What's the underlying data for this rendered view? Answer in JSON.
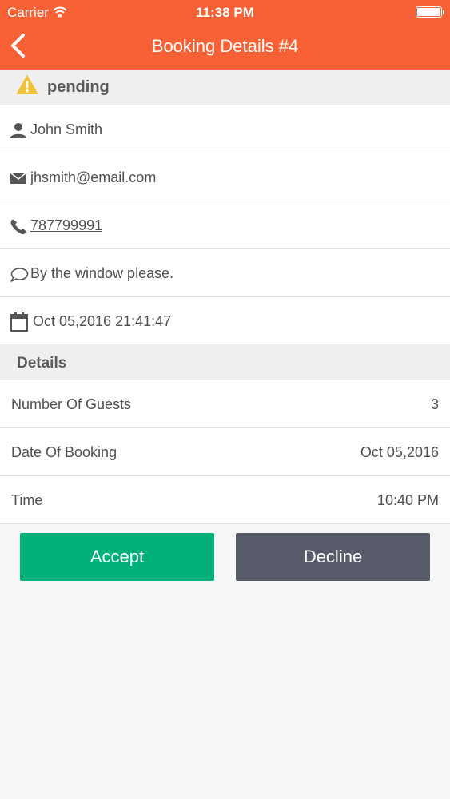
{
  "status_bar": {
    "carrier": "Carrier",
    "time": "11:38 PM",
    "icons": [
      "wifi-icon",
      "battery-icon"
    ]
  },
  "nav": {
    "title": "Booking Details #4",
    "back_icon": "chevron-left-icon"
  },
  "status": {
    "label": "pending",
    "icon": "warning-icon",
    "icon_color": "#f0c23c"
  },
  "contact": {
    "name": "John Smith",
    "email": "jhsmith@email.com",
    "phone": "787799991",
    "note": "By the window please.",
    "datetime": "Oct 05,2016 21:41:47"
  },
  "details": {
    "header": "Details",
    "rows": [
      {
        "label": "Number Of Guests",
        "value": "3"
      },
      {
        "label": "Date Of Booking",
        "value": "Oct 05,2016"
      },
      {
        "label": "Time",
        "value": "10:40 PM"
      }
    ]
  },
  "actions": {
    "accept_label": "Accept",
    "decline_label": "Decline"
  },
  "colors": {
    "header_bg": "#f76135",
    "accept": "#00b27a",
    "decline": "#575b6a",
    "section_bg": "#efeff0"
  }
}
